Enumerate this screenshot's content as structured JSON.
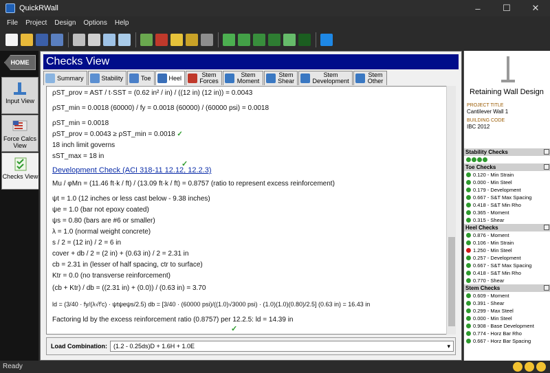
{
  "window": {
    "title": "QuickRWall",
    "min": "–",
    "max": "☐",
    "close": "✕"
  },
  "menu": [
    "File",
    "Project",
    "Design",
    "Options",
    "Help"
  ],
  "nav": {
    "home": "HOME",
    "items": [
      "Input View",
      "Force Calcs View",
      "Checks View"
    ]
  },
  "main": {
    "header": "Checks View",
    "tabs": [
      "Summary",
      "Stability",
      "Toe",
      "Heel",
      "Stem Forces",
      "Stem Moment",
      "Stem Shear",
      "Stem Development",
      "Stem Other"
    ],
    "lines": [
      "ρST_prov  =  AST / t·SST  =  (0.62 in² / in) / ((12 in) (12 in))  =  0.0043",
      "ρST_min  =  0.0018 (60000) / fy  =  0.0018 (60000) / (60000 psi)  =  0.0018",
      "ρST_min  =  0.0018",
      "ρST_prov  =  0.0043   ≥   ρST_min  =  0.0018",
      "18 inch limit governs",
      "sST_max  =  18 in",
      "Mu / φMn  =  (11.46 ft·k / ft) / (13.09 ft·k / ft)  =  0.8757        (ratio to represent excess reinforcement)",
      "ψt  =  1.0              (12 inches or less cast below  -  9.38 inches)",
      "ψe  =  1.0              (bar not epoxy coated)",
      "ψs  =  0.80             (bars are #6 or smaller)",
      "λ  =  1.0               (normal weight concrete)",
      "s / 2  =   (12 in) / 2  =  6 in",
      "cover + db / 2  =   (2 in) + (0.63 in) / 2  =  2.31 in",
      "cb  =  2.31 in           (lesser of half spacing, ctr to surface)",
      "Ktr  =  0.0              (no transverse reinforcement)",
      "(cb + Ktr) / db  =  ((2.31 in) + (0.0)) / (0.63 in)  =  3.70",
      "ld  =  (3/40 · fy/(λ√f'c) · ψtψeψs/2.5) db  =  [3/40 · (60000 psi)/((1.0)√3000 psi) · (1.0)(1.0)(0.80)/2.5] (0.63 in)  =  16.43 in",
      "Factoring ld by the excess reinforcement ratio  (0.8757)  per 12.2.5:   ld  =  14.39 in"
    ],
    "section_title": "Development Check (ACI 318-11 12.12, 12.2.3)",
    "check_mark": "✓",
    "load_label": "Load Combination:",
    "load_value": "(1.2 - 0.25ds)D + 1.6H + 1.0E",
    "dropdown_arrow": "▾"
  },
  "right": {
    "title": "Retaining Wall Design",
    "project_label": "PROJECT TITLE",
    "project_value": "Cantilever Wall 1",
    "code_label": "BUILDING CODE",
    "code_value": "IBC 2012",
    "groups": [
      {
        "name": "Stability Checks",
        "dots": 4,
        "items": []
      },
      {
        "name": "Toe Checks",
        "items": [
          {
            "t": "0.120 - Min Strain",
            "s": "ok"
          },
          {
            "t": "0.000 - Min Steel",
            "s": "ok"
          },
          {
            "t": "0.179 - Development",
            "s": "ok"
          },
          {
            "t": "0.667 - S&T Max Spacing",
            "s": "ok"
          },
          {
            "t": "0.418 - S&T Min Rho",
            "s": "ok"
          },
          {
            "t": "0.365 - Moment",
            "s": "ok"
          },
          {
            "t": "0.315 - Shear",
            "s": "ok"
          }
        ]
      },
      {
        "name": "Heel Checks",
        "items": [
          {
            "t": "0.876 - Moment",
            "s": "ok"
          },
          {
            "t": "0.106 - Min Strain",
            "s": "ok"
          },
          {
            "t": "1.250 - Min Steel",
            "s": "bad"
          },
          {
            "t": "0.257 - Development",
            "s": "ok"
          },
          {
            "t": "0.667 - S&T Max Spacing",
            "s": "ok"
          },
          {
            "t": "0.418 - S&T Min Rho",
            "s": "ok"
          },
          {
            "t": "0.770 - Shear",
            "s": "ok"
          }
        ]
      },
      {
        "name": "Stem Checks",
        "items": [
          {
            "t": "0.609 - Moment",
            "s": "ok"
          },
          {
            "t": "0.391 - Shear",
            "s": "ok"
          },
          {
            "t": "0.299 - Max Steel",
            "s": "ok"
          },
          {
            "t": "0.000 - Min Steel",
            "s": "ok"
          },
          {
            "t": "0.908 - Base Development",
            "s": "ok"
          },
          {
            "t": "0.774 - Horz Bar Rho",
            "s": "ok"
          },
          {
            "t": "0.667 - Horz Bar Spacing",
            "s": "ok"
          }
        ]
      }
    ]
  },
  "status": {
    "text": "Ready"
  },
  "colors": {
    "header_blue": "#000d8a",
    "ok": "#2e9a2e",
    "fail": "#d01818",
    "link": "#0a2ca8"
  }
}
